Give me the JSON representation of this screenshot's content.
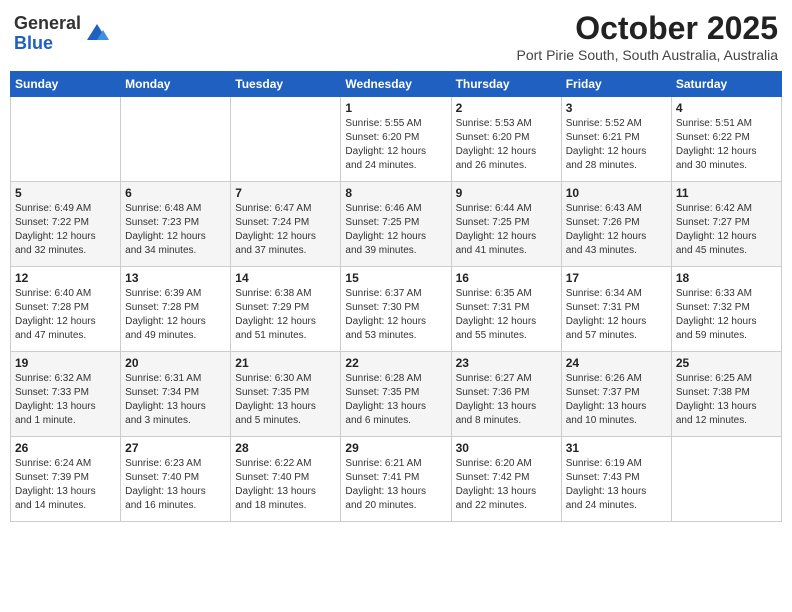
{
  "logo": {
    "general": "General",
    "blue": "Blue"
  },
  "header": {
    "month": "October 2025",
    "location": "Port Pirie South, South Australia, Australia"
  },
  "weekdays": [
    "Sunday",
    "Monday",
    "Tuesday",
    "Wednesday",
    "Thursday",
    "Friday",
    "Saturday"
  ],
  "weeks": [
    [
      {
        "day": "",
        "info": ""
      },
      {
        "day": "",
        "info": ""
      },
      {
        "day": "",
        "info": ""
      },
      {
        "day": "1",
        "info": "Sunrise: 5:55 AM\nSunset: 6:20 PM\nDaylight: 12 hours\nand 24 minutes."
      },
      {
        "day": "2",
        "info": "Sunrise: 5:53 AM\nSunset: 6:20 PM\nDaylight: 12 hours\nand 26 minutes."
      },
      {
        "day": "3",
        "info": "Sunrise: 5:52 AM\nSunset: 6:21 PM\nDaylight: 12 hours\nand 28 minutes."
      },
      {
        "day": "4",
        "info": "Sunrise: 5:51 AM\nSunset: 6:22 PM\nDaylight: 12 hours\nand 30 minutes."
      }
    ],
    [
      {
        "day": "5",
        "info": "Sunrise: 6:49 AM\nSunset: 7:22 PM\nDaylight: 12 hours\nand 32 minutes."
      },
      {
        "day": "6",
        "info": "Sunrise: 6:48 AM\nSunset: 7:23 PM\nDaylight: 12 hours\nand 34 minutes."
      },
      {
        "day": "7",
        "info": "Sunrise: 6:47 AM\nSunset: 7:24 PM\nDaylight: 12 hours\nand 37 minutes."
      },
      {
        "day": "8",
        "info": "Sunrise: 6:46 AM\nSunset: 7:25 PM\nDaylight: 12 hours\nand 39 minutes."
      },
      {
        "day": "9",
        "info": "Sunrise: 6:44 AM\nSunset: 7:25 PM\nDaylight: 12 hours\nand 41 minutes."
      },
      {
        "day": "10",
        "info": "Sunrise: 6:43 AM\nSunset: 7:26 PM\nDaylight: 12 hours\nand 43 minutes."
      },
      {
        "day": "11",
        "info": "Sunrise: 6:42 AM\nSunset: 7:27 PM\nDaylight: 12 hours\nand 45 minutes."
      }
    ],
    [
      {
        "day": "12",
        "info": "Sunrise: 6:40 AM\nSunset: 7:28 PM\nDaylight: 12 hours\nand 47 minutes."
      },
      {
        "day": "13",
        "info": "Sunrise: 6:39 AM\nSunset: 7:28 PM\nDaylight: 12 hours\nand 49 minutes."
      },
      {
        "day": "14",
        "info": "Sunrise: 6:38 AM\nSunset: 7:29 PM\nDaylight: 12 hours\nand 51 minutes."
      },
      {
        "day": "15",
        "info": "Sunrise: 6:37 AM\nSunset: 7:30 PM\nDaylight: 12 hours\nand 53 minutes."
      },
      {
        "day": "16",
        "info": "Sunrise: 6:35 AM\nSunset: 7:31 PM\nDaylight: 12 hours\nand 55 minutes."
      },
      {
        "day": "17",
        "info": "Sunrise: 6:34 AM\nSunset: 7:31 PM\nDaylight: 12 hours\nand 57 minutes."
      },
      {
        "day": "18",
        "info": "Sunrise: 6:33 AM\nSunset: 7:32 PM\nDaylight: 12 hours\nand 59 minutes."
      }
    ],
    [
      {
        "day": "19",
        "info": "Sunrise: 6:32 AM\nSunset: 7:33 PM\nDaylight: 13 hours\nand 1 minute."
      },
      {
        "day": "20",
        "info": "Sunrise: 6:31 AM\nSunset: 7:34 PM\nDaylight: 13 hours\nand 3 minutes."
      },
      {
        "day": "21",
        "info": "Sunrise: 6:30 AM\nSunset: 7:35 PM\nDaylight: 13 hours\nand 5 minutes."
      },
      {
        "day": "22",
        "info": "Sunrise: 6:28 AM\nSunset: 7:35 PM\nDaylight: 13 hours\nand 6 minutes."
      },
      {
        "day": "23",
        "info": "Sunrise: 6:27 AM\nSunset: 7:36 PM\nDaylight: 13 hours\nand 8 minutes."
      },
      {
        "day": "24",
        "info": "Sunrise: 6:26 AM\nSunset: 7:37 PM\nDaylight: 13 hours\nand 10 minutes."
      },
      {
        "day": "25",
        "info": "Sunrise: 6:25 AM\nSunset: 7:38 PM\nDaylight: 13 hours\nand 12 minutes."
      }
    ],
    [
      {
        "day": "26",
        "info": "Sunrise: 6:24 AM\nSunset: 7:39 PM\nDaylight: 13 hours\nand 14 minutes."
      },
      {
        "day": "27",
        "info": "Sunrise: 6:23 AM\nSunset: 7:40 PM\nDaylight: 13 hours\nand 16 minutes."
      },
      {
        "day": "28",
        "info": "Sunrise: 6:22 AM\nSunset: 7:40 PM\nDaylight: 13 hours\nand 18 minutes."
      },
      {
        "day": "29",
        "info": "Sunrise: 6:21 AM\nSunset: 7:41 PM\nDaylight: 13 hours\nand 20 minutes."
      },
      {
        "day": "30",
        "info": "Sunrise: 6:20 AM\nSunset: 7:42 PM\nDaylight: 13 hours\nand 22 minutes."
      },
      {
        "day": "31",
        "info": "Sunrise: 6:19 AM\nSunset: 7:43 PM\nDaylight: 13 hours\nand 24 minutes."
      },
      {
        "day": "",
        "info": ""
      }
    ]
  ]
}
